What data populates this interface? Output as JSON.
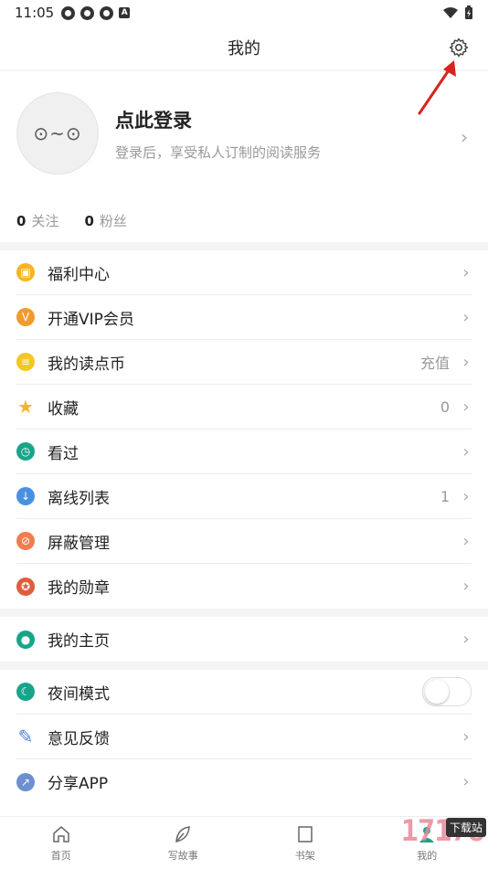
{
  "status": {
    "time": "11:05"
  },
  "title": "我的",
  "profile": {
    "avatar_face": "⊙~⊙",
    "login": "点此登录",
    "subtitle": "登录后，享受私人订制的阅读服务",
    "stats": [
      {
        "count": "0",
        "label": "关注"
      },
      {
        "count": "0",
        "label": "粉丝"
      }
    ]
  },
  "menu1": [
    {
      "label": "福利中心",
      "value": "",
      "icon": "gift-icon",
      "color": "#f6b51e"
    },
    {
      "label": "开通VIP会员",
      "value": "",
      "icon": "vip-icon",
      "color": "#f39a2d"
    },
    {
      "label": "我的读点币",
      "value": "充值",
      "icon": "coin-icon",
      "color": "#f5c625"
    },
    {
      "label": "收藏",
      "value": "0",
      "icon": "star-icon",
      "color": "#f7b52a"
    },
    {
      "label": "看过",
      "value": "",
      "icon": "clock-icon",
      "color": "#17a58a"
    },
    {
      "label": "离线列表",
      "value": "1",
      "icon": "download-icon",
      "color": "#4a90e2"
    },
    {
      "label": "屏蔽管理",
      "value": "",
      "icon": "block-icon",
      "color": "#f07d4e"
    },
    {
      "label": "我的勋章",
      "value": "",
      "icon": "medal-icon",
      "color": "#e05c3c"
    }
  ],
  "menu2": [
    {
      "label": "我的主页",
      "value": "",
      "icon": "person-icon",
      "color": "#17a58a"
    }
  ],
  "menu3": [
    {
      "label": "夜间模式",
      "icon": "moon-icon",
      "color": "#17a58a"
    },
    {
      "label": "意见反馈",
      "icon": "pen-icon",
      "color": "#4a7fd4"
    },
    {
      "label": "分享APP",
      "icon": "share-icon",
      "color": "#6c8fd0"
    }
  ],
  "tabs": [
    {
      "label": "首页",
      "icon": "home-icon"
    },
    {
      "label": "写故事",
      "icon": "leaf-icon"
    },
    {
      "label": "书架",
      "icon": "book-icon"
    },
    {
      "label": "我的",
      "icon": "user-icon"
    }
  ],
  "watermark": {
    "text": "17178",
    "tag": "下载站"
  }
}
